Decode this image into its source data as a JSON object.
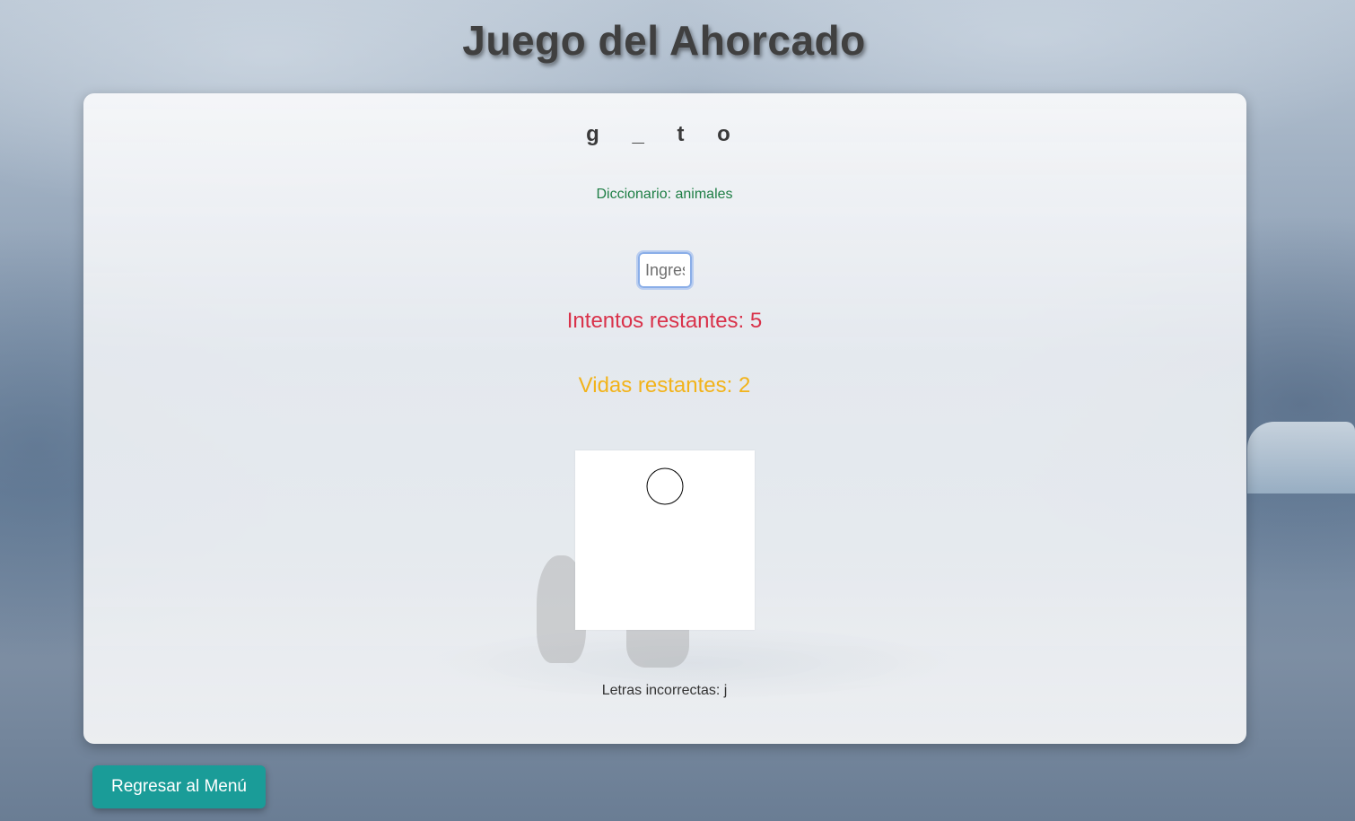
{
  "header": {
    "title": "Juego del Ahorcado"
  },
  "game": {
    "word_display": "g _ t o",
    "dictionary_text": "Diccionario: animales",
    "input_placeholder": "Ingresa una letra",
    "attempts_text": "Intentos restantes: 5",
    "lives_text": "Vidas restantes: 2",
    "wrong_letters_text": "Letras incorrectas: j"
  },
  "hangman": {
    "parts_drawn": [
      "head"
    ]
  },
  "footer": {
    "menu_button_label": "Regresar al Menú"
  },
  "colors": {
    "attempts": "#d9324a",
    "lives": "#f2b31a",
    "dictionary": "#1e7e45",
    "menu_button": "#1a9c98"
  }
}
